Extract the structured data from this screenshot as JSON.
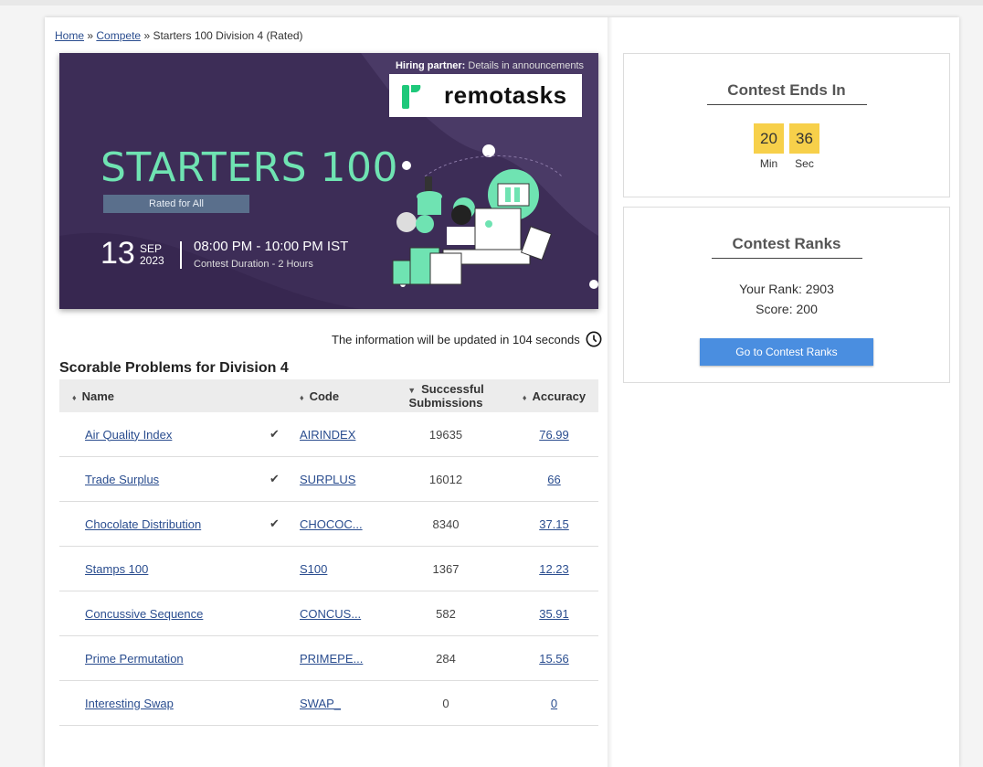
{
  "breadcrumb": {
    "home": "Home",
    "sep1": "»",
    "compete": "Compete",
    "sep2": "»",
    "current": "Starters 100 Division 4 (Rated)"
  },
  "banner": {
    "hiring_bold": "Hiring partner:",
    "hiring_rest": "Details in announcements",
    "partner": "remotasks",
    "title": "STARTERS 100",
    "rated": "Rated for All",
    "day": "13",
    "month": "SEP",
    "year": "2023",
    "time": "08:00 PM - 10:00 PM IST",
    "duration": "Contest Duration - 2 Hours",
    "brand_color": "#6fe3b2"
  },
  "update_notice": "The information will be updated in 104 seconds",
  "problems": {
    "heading": "Scorable Problems for Division 4",
    "columns": {
      "name": "Name",
      "code": "Code",
      "submissions": "Successful Submissions",
      "accuracy": "Accuracy"
    },
    "rows": [
      {
        "name": "Air Quality Index",
        "solved": true,
        "code": "AIRINDEX",
        "submissions": "19635",
        "accuracy": "76.99"
      },
      {
        "name": "Trade Surplus",
        "solved": true,
        "code": "SURPLUS",
        "submissions": "16012",
        "accuracy": "66"
      },
      {
        "name": "Chocolate Distribution",
        "solved": true,
        "code": "CHOCOC...",
        "submissions": "8340",
        "accuracy": "37.15"
      },
      {
        "name": "Stamps 100",
        "solved": false,
        "code": "S100",
        "submissions": "1367",
        "accuracy": "12.23"
      },
      {
        "name": "Concussive Sequence",
        "solved": false,
        "code": "CONCUS...",
        "submissions": "582",
        "accuracy": "35.91"
      },
      {
        "name": "Prime Permutation",
        "solved": false,
        "code": "PRIMEPE...",
        "submissions": "284",
        "accuracy": "15.56"
      },
      {
        "name": "Interesting Swap",
        "solved": false,
        "code": "SWAP_",
        "submissions": "0",
        "accuracy": "0"
      }
    ]
  },
  "contest_timer": {
    "title": "Contest Ends In",
    "min": "20",
    "min_label": "Min",
    "sec": "36",
    "sec_label": "Sec"
  },
  "contest_ranks": {
    "title": "Contest Ranks",
    "rank_text": "Your Rank: 2903",
    "score_text": "Score: 200",
    "button": "Go to Contest Ranks"
  },
  "colors": {
    "accent": "#4a8ee0",
    "timer_bg": "#f7d04a",
    "check": "#5cb85c",
    "banner_bg": "#3d2d57"
  }
}
